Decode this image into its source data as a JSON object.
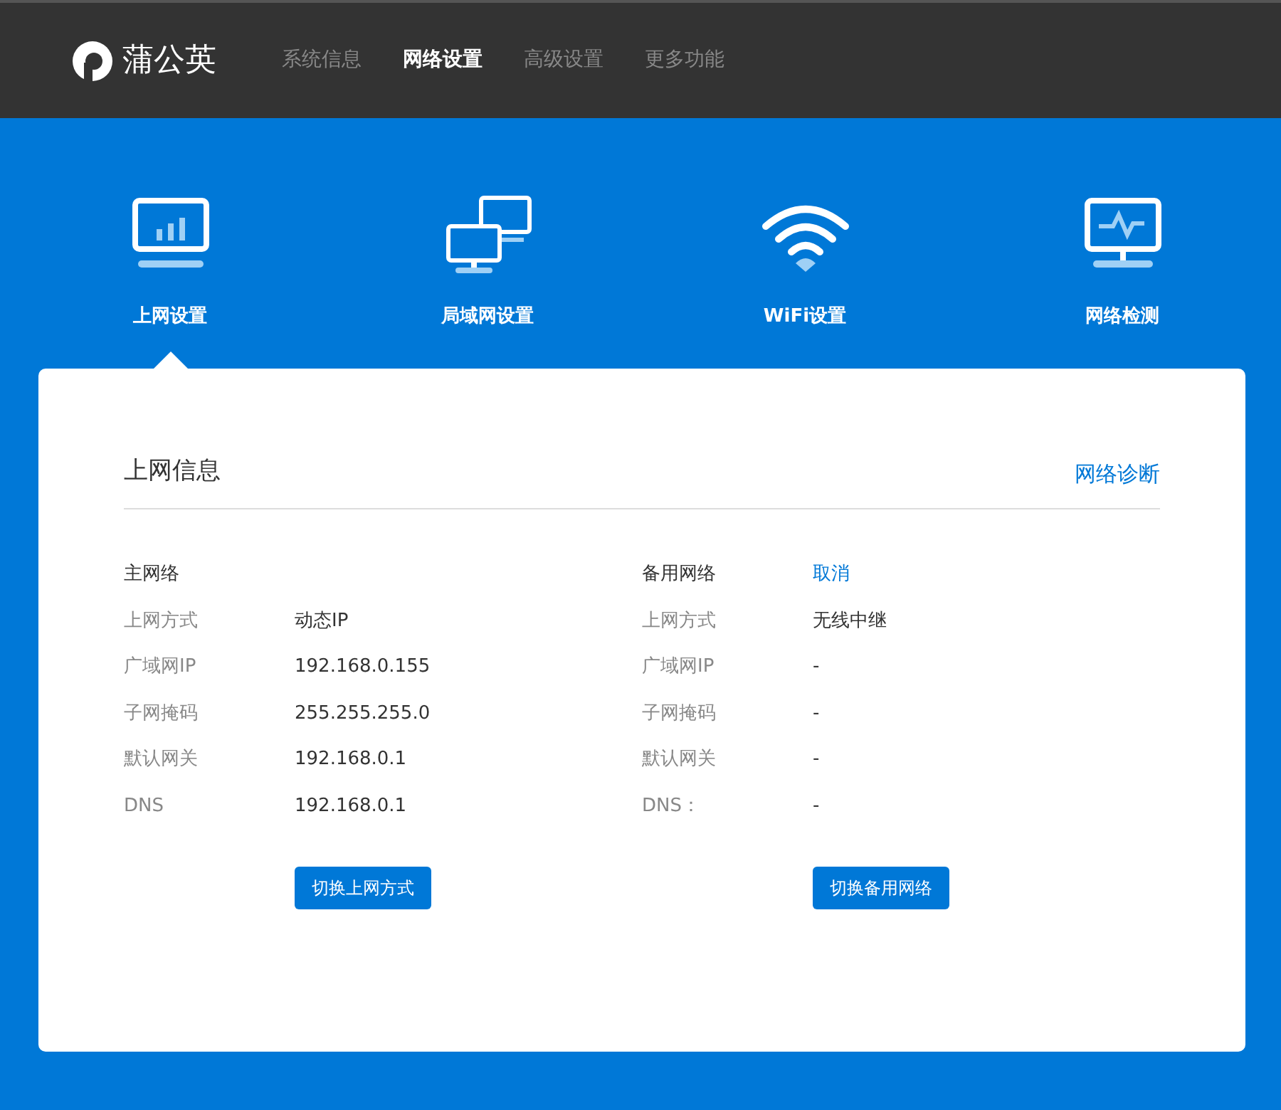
{
  "brand": "蒲公英",
  "nav": [
    {
      "label": "系统信息",
      "selected": false
    },
    {
      "label": "网络设置",
      "selected": true
    },
    {
      "label": "高级设置",
      "selected": false
    },
    {
      "label": "更多功能",
      "selected": false
    }
  ],
  "categories": [
    {
      "label": "上网设置",
      "kind": "monitor-chart",
      "selected": true
    },
    {
      "label": "局域网设置",
      "kind": "two-monitors",
      "selected": false
    },
    {
      "label": "WiFi设置",
      "kind": "wifi",
      "selected": false
    },
    {
      "label": "网络检测",
      "kind": "monitor-pulse",
      "selected": false
    }
  ],
  "section": {
    "title": "上网信息",
    "link": "网络诊断"
  },
  "networks": [
    {
      "title": "主网络",
      "rows": [
        {
          "label": "上网方式",
          "value": "动态IP"
        },
        {
          "label": "广域网IP",
          "value": "192.168.0.155"
        },
        {
          "label": "子网掩码",
          "value": "255.255.255.0"
        },
        {
          "label": "默认网关",
          "value": "192.168.0.1"
        },
        {
          "label": "DNS",
          "value": "192.168.0.1"
        }
      ],
      "button": "切换上网方式"
    },
    {
      "title": "备用网络",
      "action": "取消",
      "rows": [
        {
          "label": "上网方式",
          "value": "无线中继"
        },
        {
          "label": "广域网IP",
          "value": "-"
        },
        {
          "label": "子网掩码",
          "value": "-"
        },
        {
          "label": "默认网关",
          "value": "-"
        },
        {
          "label": "DNS：",
          "value": "-"
        }
      ],
      "button": "切换备用网络"
    }
  ]
}
